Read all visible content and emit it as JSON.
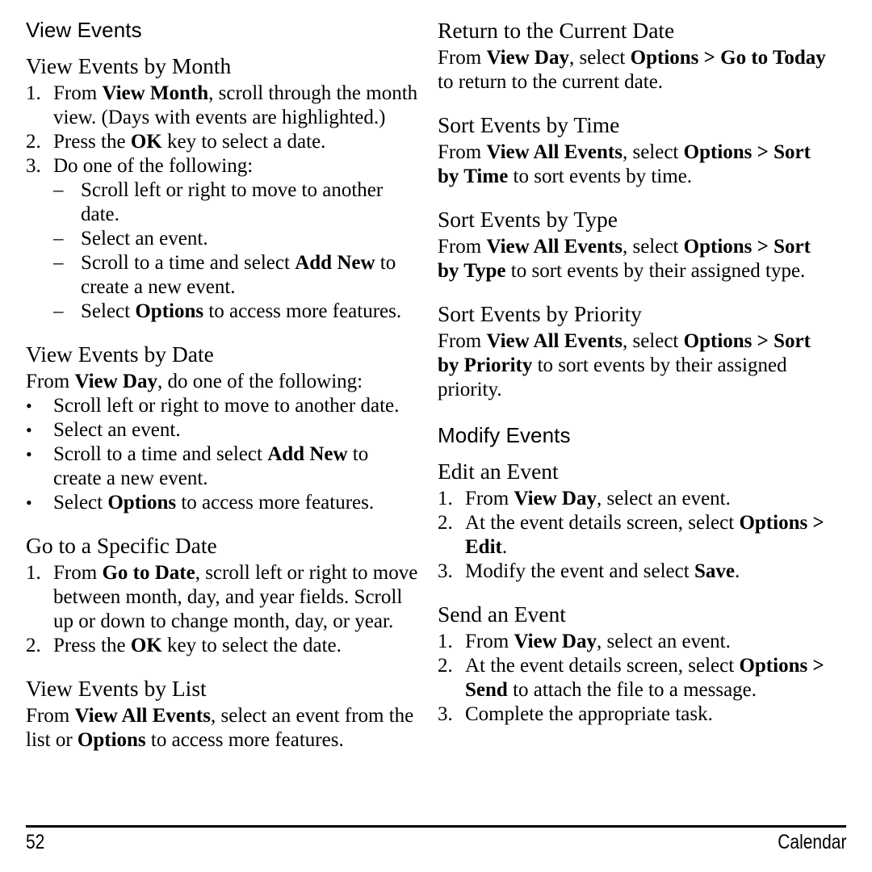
{
  "page": {
    "number": "52",
    "chapter": "Calendar"
  },
  "left_column": {
    "section_heading": "View Events",
    "blocks": [
      {
        "heading": "View Events by Month",
        "steps": [
          {
            "marker": "1.",
            "parts": [
              {
                "t": "From ",
                "b": false
              },
              {
                "t": "View Month",
                "b": true
              },
              {
                "t": ", scroll through the month view. (Days with events are highlighted.)",
                "b": false
              }
            ]
          },
          {
            "marker": "2.",
            "parts": [
              {
                "t": "Press the ",
                "b": false
              },
              {
                "t": "OK",
                "b": true
              },
              {
                "t": " key to select a date.",
                "b": false
              }
            ]
          },
          {
            "marker": "3.",
            "parts": [
              {
                "t": "Do one of the following:",
                "b": false
              }
            ],
            "sub": [
              {
                "marker": "–",
                "parts": [
                  {
                    "t": "Scroll left or right to move to another date.",
                    "b": false
                  }
                ]
              },
              {
                "marker": "–",
                "parts": [
                  {
                    "t": "Select an event.",
                    "b": false
                  }
                ]
              },
              {
                "marker": "–",
                "parts": [
                  {
                    "t": "Scroll to a time and select ",
                    "b": false
                  },
                  {
                    "t": "Add New",
                    "b": true
                  },
                  {
                    "t": " to create a new event.",
                    "b": false
                  }
                ]
              },
              {
                "marker": "–",
                "parts": [
                  {
                    "t": "Select ",
                    "b": false
                  },
                  {
                    "t": "Options",
                    "b": true
                  },
                  {
                    "t": " to access more features.",
                    "b": false
                  }
                ]
              }
            ]
          }
        ]
      },
      {
        "heading": "View Events by Date",
        "intro": [
          {
            "t": "From ",
            "b": false
          },
          {
            "t": "View Day",
            "b": true
          },
          {
            "t": ", do one of the following:",
            "b": false
          }
        ],
        "bullets": [
          {
            "marker": "•",
            "parts": [
              {
                "t": "Scroll left or right to move to another date.",
                "b": false
              }
            ]
          },
          {
            "marker": "•",
            "parts": [
              {
                "t": "Select an event.",
                "b": false
              }
            ]
          },
          {
            "marker": "•",
            "parts": [
              {
                "t": "Scroll to a time and select ",
                "b": false
              },
              {
                "t": "Add New",
                "b": true
              },
              {
                "t": " to create a new event.",
                "b": false
              }
            ]
          },
          {
            "marker": "•",
            "parts": [
              {
                "t": "Select ",
                "b": false
              },
              {
                "t": "Options",
                "b": true
              },
              {
                "t": " to access more features.",
                "b": false
              }
            ]
          }
        ]
      },
      {
        "heading": "Go to a Specific Date",
        "steps": [
          {
            "marker": "1.",
            "parts": [
              {
                "t": "From ",
                "b": false
              },
              {
                "t": "Go to Date",
                "b": true
              },
              {
                "t": ", scroll left or right to move between month, day, and year fields. Scroll up or down to change month, day, or year.",
                "b": false
              }
            ]
          },
          {
            "marker": "2.",
            "parts": [
              {
                "t": "Press the ",
                "b": false
              },
              {
                "t": "OK",
                "b": true
              },
              {
                "t": " key to select the date.",
                "b": false
              }
            ]
          }
        ]
      },
      {
        "heading": "View Events by List",
        "paragraph": [
          {
            "t": "From ",
            "b": false
          },
          {
            "t": "View All Events",
            "b": true
          },
          {
            "t": ", select an event from the list or ",
            "b": false
          },
          {
            "t": "Options",
            "b": true
          },
          {
            "t": " to access more features.",
            "b": false
          }
        ]
      }
    ]
  },
  "right_column": {
    "blocks": [
      {
        "heading": "Return to the Current Date",
        "paragraph": [
          {
            "t": "From ",
            "b": false
          },
          {
            "t": "View Day",
            "b": true
          },
          {
            "t": ", select ",
            "b": false
          },
          {
            "t": "Options > Go to Today",
            "b": true
          },
          {
            "t": " to return to the current date.",
            "b": false
          }
        ]
      },
      {
        "heading": "Sort Events by Time",
        "paragraph": [
          {
            "t": "From ",
            "b": false
          },
          {
            "t": "View All Events",
            "b": true
          },
          {
            "t": ", select ",
            "b": false
          },
          {
            "t": "Options > Sort by Time",
            "b": true
          },
          {
            "t": " to sort events by time.",
            "b": false
          }
        ]
      },
      {
        "heading": "Sort Events by Type",
        "paragraph": [
          {
            "t": "From ",
            "b": false
          },
          {
            "t": "View All Events",
            "b": true
          },
          {
            "t": ", select ",
            "b": false
          },
          {
            "t": "Options > Sort by Type",
            "b": true
          },
          {
            "t": " to sort events by their assigned type.",
            "b": false
          }
        ]
      },
      {
        "heading": "Sort Events by Priority",
        "paragraph": [
          {
            "t": "From ",
            "b": false
          },
          {
            "t": "View All Events",
            "b": true
          },
          {
            "t": ", select ",
            "b": false
          },
          {
            "t": "Options > Sort by Priority",
            "b": true
          },
          {
            "t": " to sort events by their assigned priority.",
            "b": false
          }
        ]
      }
    ],
    "section_heading": "Modify Events",
    "blocks2": [
      {
        "heading": "Edit an Event",
        "steps": [
          {
            "marker": "1.",
            "parts": [
              {
                "t": "From ",
                "b": false
              },
              {
                "t": "View Day",
                "b": true
              },
              {
                "t": ", select an event.",
                "b": false
              }
            ]
          },
          {
            "marker": "2.",
            "parts": [
              {
                "t": "At the event details screen, select ",
                "b": false
              },
              {
                "t": "Options > Edit",
                "b": true
              },
              {
                "t": ".",
                "b": false
              }
            ]
          },
          {
            "marker": "3.",
            "parts": [
              {
                "t": "Modify the event and select ",
                "b": false
              },
              {
                "t": "Save",
                "b": true
              },
              {
                "t": ".",
                "b": false
              }
            ]
          }
        ]
      },
      {
        "heading": "Send an Event",
        "steps": [
          {
            "marker": "1.",
            "parts": [
              {
                "t": "From ",
                "b": false
              },
              {
                "t": "View Day",
                "b": true
              },
              {
                "t": ", select an event.",
                "b": false
              }
            ]
          },
          {
            "marker": "2.",
            "parts": [
              {
                "t": "At the event details screen, select ",
                "b": false
              },
              {
                "t": "Options > Send",
                "b": true
              },
              {
                "t": " to attach the file to a message.",
                "b": false
              }
            ]
          },
          {
            "marker": "3.",
            "parts": [
              {
                "t": "Complete the appropriate task.",
                "b": false
              }
            ]
          }
        ]
      }
    ]
  }
}
